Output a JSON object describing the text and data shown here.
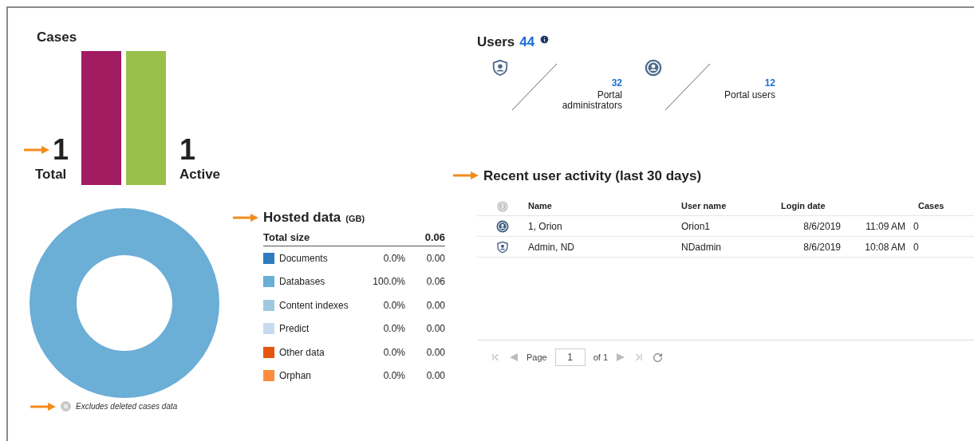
{
  "cases": {
    "title": "Cases",
    "stats": [
      {
        "value": "1",
        "label": "Total",
        "color": "#a21c62"
      },
      {
        "value": "1",
        "label": "Active",
        "color": "#99c04a"
      }
    ]
  },
  "users": {
    "title": "Users",
    "count": "44",
    "groups": [
      {
        "kind": "admin",
        "count": "32",
        "label": "Portal administrators"
      },
      {
        "kind": "user",
        "count": "12",
        "label": "Portal users"
      }
    ]
  },
  "hosted_data": {
    "title": "Hosted data",
    "unit": "(GB)",
    "total_label": "Total size",
    "total_value": "0.06",
    "rows": [
      {
        "label": "Documents",
        "percent": "0.0%",
        "value": "0.00",
        "color": "#2e7bbf"
      },
      {
        "label": "Databases",
        "percent": "100.0%",
        "value": "0.06",
        "color": "#6baed6"
      },
      {
        "label": "Content indexes",
        "percent": "0.0%",
        "value": "0.00",
        "color": "#9ecae1"
      },
      {
        "label": "Predict",
        "percent": "0.0%",
        "value": "0.00",
        "color": "#c6dbef"
      },
      {
        "label": "Other data",
        "percent": "0.0%",
        "value": "0.00",
        "color": "#e6550d"
      },
      {
        "label": "Orphan",
        "percent": "0.0%",
        "value": "0.00",
        "color": "#fd8d3c"
      }
    ],
    "note": "Excludes deleted cases data"
  },
  "recent_activity": {
    "title": "Recent user activity (last 30 days)",
    "columns": [
      "Name",
      "User name",
      "Login date",
      "Cases"
    ],
    "rows": [
      {
        "kind": "user",
        "name": "1, Orion",
        "user_name": "Orion1",
        "date": "8/6/2019",
        "time": "11:09 AM",
        "cases": "0"
      },
      {
        "kind": "admin",
        "name": "Admin, ND",
        "user_name": "NDadmin",
        "date": "8/6/2019",
        "time": "10:08 AM",
        "cases": "0"
      }
    ],
    "pager": {
      "page_label": "Page",
      "page": "1",
      "of": "of 1"
    }
  }
}
